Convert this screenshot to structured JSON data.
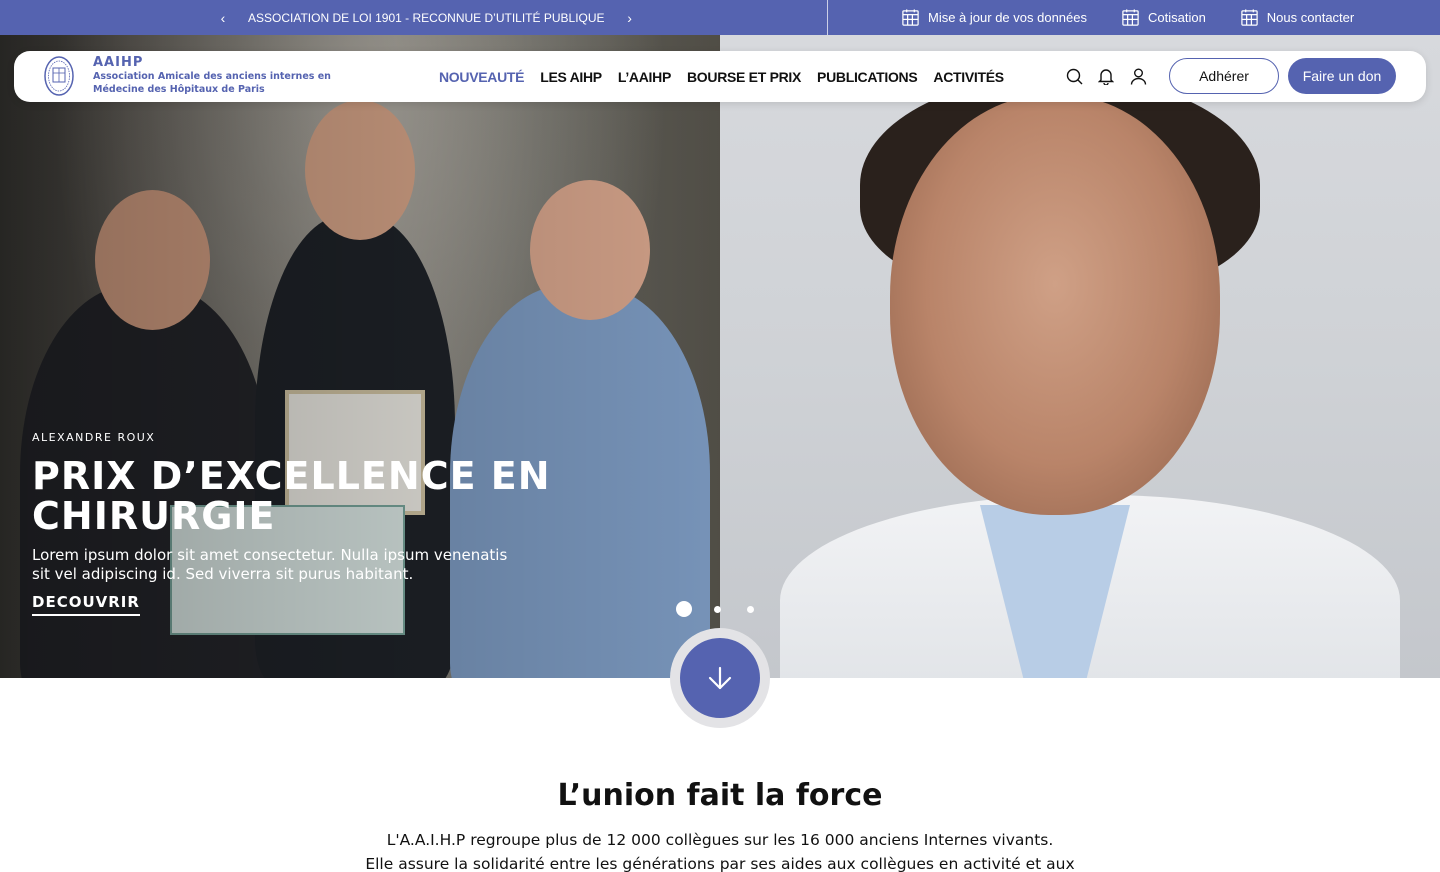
{
  "topbar": {
    "announcement": "ASSOCIATION DE LOI 1901 - RECONNUE D’UTILITÉ PUBLIQUE",
    "links": [
      {
        "label": "Mise à jour de vos données",
        "icon": "calendar-icon"
      },
      {
        "label": "Cotisation",
        "icon": "calendar-icon"
      },
      {
        "label": "Nous contacter",
        "icon": "calendar-icon"
      }
    ],
    "color": "#5563b0"
  },
  "header": {
    "brand_name": "AAIHP",
    "brand_line1": "Association Amicale des anciens internes en",
    "brand_line2": "Médecine des Hôpitaux de Paris",
    "nav": [
      "NOUVEAUTÉ",
      "LES AIHP",
      "L’AAIHP",
      "BOURSE ET PRIX",
      "PUBLICATIONS",
      "ACTIVITÉS"
    ],
    "active_nav": "NOUVEAUTÉ",
    "join_label": "Adhérer",
    "donate_label": "Faire un don",
    "accent": "#5563b0"
  },
  "hero": {
    "kicker": "ALEXANDRE ROUX",
    "title_line1": "PRIX D’EXCELLENCE EN",
    "title_line2": "CHIRURGIE",
    "description": "Lorem ipsum dolor sit amet consectetur. Nulla ipsum venenatis sit vel adipiscing id. Sed viverra sit purus habitant.",
    "cta": "DECOUVRIR",
    "slide_count": 3,
    "active_slide": 1
  },
  "section": {
    "title": "L’union fait la force",
    "text_line1": "L'A.A.I.H.P regroupe plus de 12 000 collègues sur les 16 000 anciens Internes vivants.",
    "text_line2": "Elle assure la solidarité entre les générations par ses aides aux collègues en activité et aux"
  }
}
